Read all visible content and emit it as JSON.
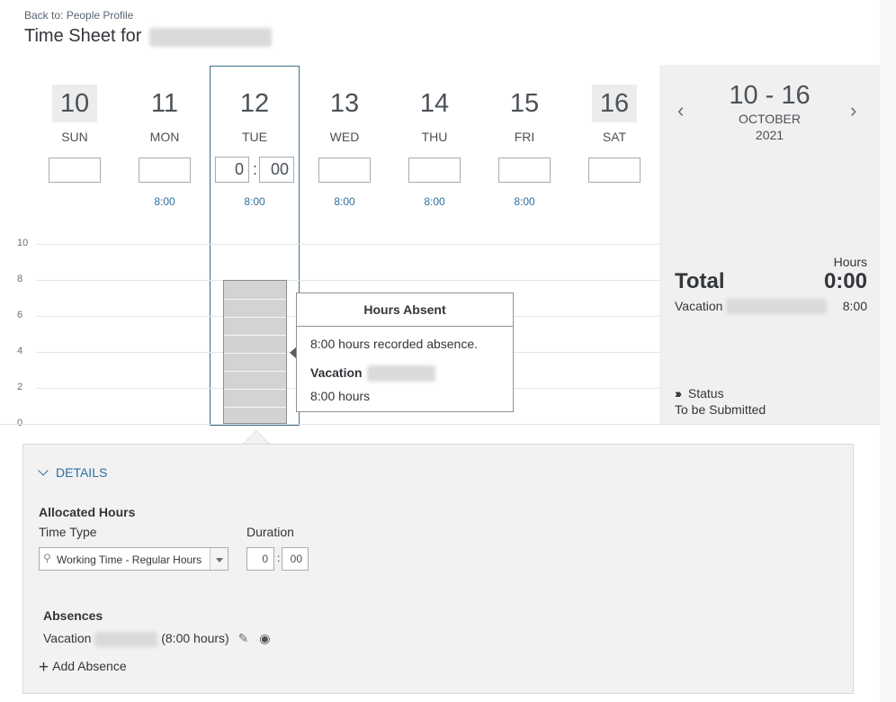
{
  "header": {
    "back_link": "Back to: People Profile",
    "title_prefix": "Time Sheet for"
  },
  "days": [
    {
      "num": "10",
      "dow": "SUN",
      "scheduled": ""
    },
    {
      "num": "11",
      "dow": "MON",
      "scheduled": "8:00"
    },
    {
      "num": "12",
      "dow": "TUE",
      "scheduled": "8:00"
    },
    {
      "num": "13",
      "dow": "WED",
      "scheduled": "8:00"
    },
    {
      "num": "14",
      "dow": "THU",
      "scheduled": "8:00"
    },
    {
      "num": "15",
      "dow": "FRI",
      "scheduled": "8:00"
    },
    {
      "num": "16",
      "dow": "SAT",
      "scheduled": ""
    }
  ],
  "selected_day_time": {
    "hours": "0",
    "minutes": "00"
  },
  "chart_data": {
    "type": "bar",
    "categories": [
      "SUN",
      "MON",
      "TUE",
      "WED",
      "THU",
      "FRI",
      "SAT"
    ],
    "values": [
      0,
      0,
      8,
      0,
      0,
      0,
      0
    ],
    "yticks": [
      "0",
      "2",
      "4",
      "6",
      "8",
      "10"
    ],
    "ylim": [
      0,
      10
    ]
  },
  "tooltip": {
    "title": "Hours Absent",
    "line1": "8:00 hours recorded absence.",
    "type": "Vacation",
    "hours": "8:00 hours"
  },
  "summary": {
    "range": "10 - 16",
    "month": "OCTOBER",
    "year": "2021",
    "hours_label": "Hours",
    "total_label": "Total",
    "total_value": "0:00",
    "vacation_label": "Vacation",
    "vacation_value": "8:00",
    "status_label": "Status",
    "status_value": "To be Submitted",
    "prev_icon": "chevron-left-icon",
    "next_icon": "chevron-right-icon"
  },
  "details": {
    "toggle_label": "DETAILS",
    "allocated_title": "Allocated Hours",
    "time_type_label": "Time Type",
    "duration_label": "Duration",
    "time_type_value": "Working Time - Regular Hours",
    "duration_hours": "0",
    "duration_minutes": "00",
    "absences_title": "Absences",
    "absence_type": "Vacation",
    "absence_hours": "(8:00 hours)",
    "add_absence": "Add Absence"
  },
  "colors": {
    "accent": "#2c6e9e",
    "selected_border": "#3a6f8e",
    "bar_fill": "#d3d3d4",
    "panel_bg": "#f0f0f0"
  }
}
